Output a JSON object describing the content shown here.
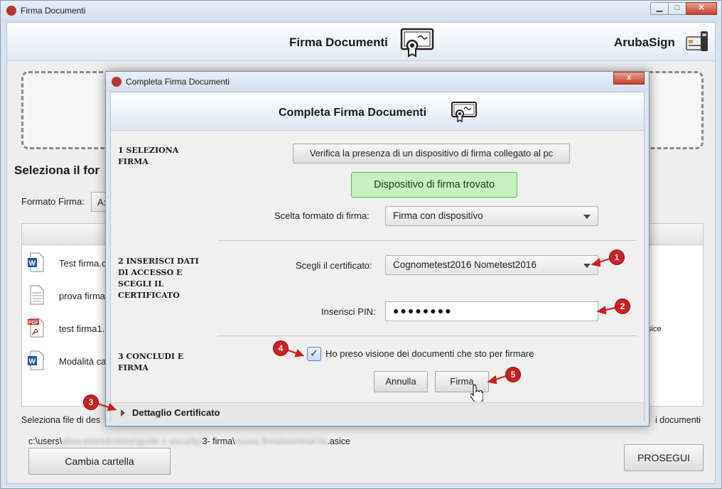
{
  "main_window": {
    "title": "Firma Documenti",
    "header_title": "Firma Documenti",
    "brand": "ArubaSign",
    "section_title": "Seleziona il for",
    "format_label": "Formato Firma:",
    "format_value": "A:",
    "files": [
      {
        "name": "Test firma.c",
        "type": "word-doc-icon"
      },
      {
        "name": "prova firma",
        "type": "text-doc-icon"
      },
      {
        "name": "test firma1.",
        "type": "pdf-doc-icon"
      },
      {
        "name": "Modalità ca",
        "type": "word-doc-icon"
      }
    ],
    "file_suffix_right": "sice",
    "bottom_left_text": "Seleziona file di des",
    "bottom_right_text": "i documenti",
    "path": {
      "prefix": "c:\\users\\",
      "blurred1": "alisa.asim\\desktop\\guide e security\\",
      "mid": "3- firma\\",
      "blurred2": "nuova firma\\nominaFile",
      "suffix": ".asice"
    },
    "change_folder_label": "Cambia cartella",
    "proceed_label": "PROSEGUI"
  },
  "dialog": {
    "title": "Completa Firma Documenti",
    "header_title": "Completa Firma Documenti",
    "close_label": "x",
    "step1_label": "1 SELEZIONA FIRMA",
    "verify_button": "Verifica la presenza di un dispositivo di firma collegato al pc",
    "device_found": "Dispositivo di firma trovato",
    "format_label": "Scelta formato di firma:",
    "format_value": "Firma con dispositivo",
    "step2_label": "2 INSERISCI DATI DI ACCESSO E SCEGLI IL CERTIFICATO",
    "cert_label": "Scegli il certificato:",
    "cert_value": "Cognometest2016 Nometest2016",
    "pin_label": "Inserisci PIN:",
    "pin_value": "●●●●●●●●",
    "step3_label": "3 CONCLUDI E FIRMA",
    "checkbox_checked": true,
    "checkbox_label": "Ho preso visione dei documenti che sto per firmare",
    "cancel_label": "Annulla",
    "sign_label": "Firma",
    "details_label": "Dettaglio Certificato"
  },
  "callouts": [
    "1",
    "2",
    "3",
    "4",
    "5"
  ],
  "colors": {
    "callout": "#d01f1f",
    "found_bg": "#c8f0c0",
    "found_border": "#58b858"
  }
}
